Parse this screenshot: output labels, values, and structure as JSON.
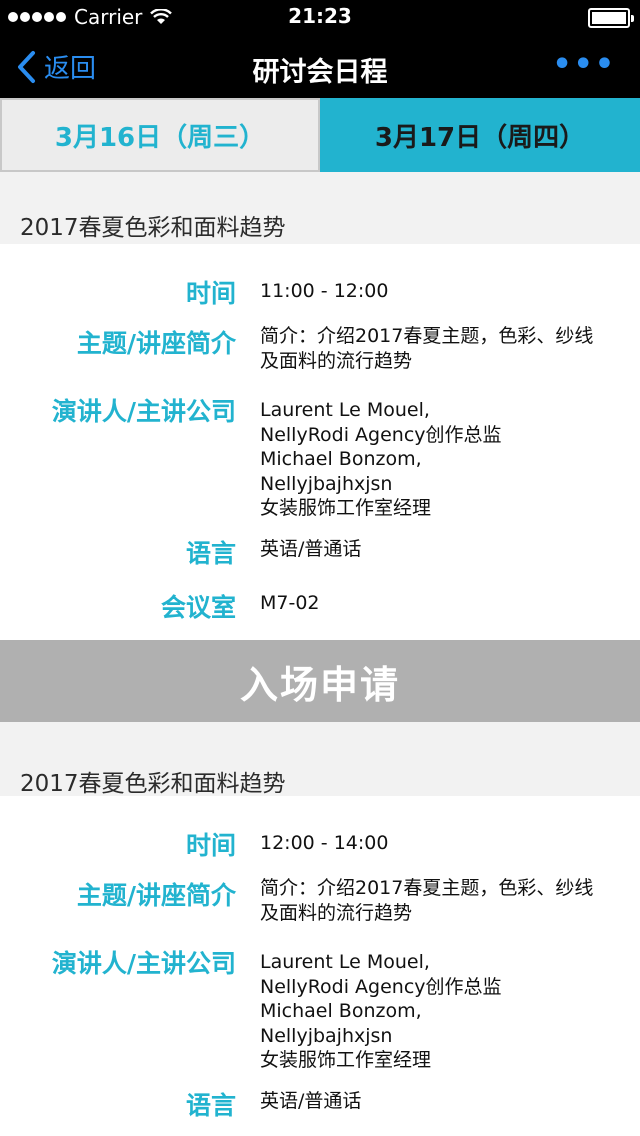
{
  "statusbar": {
    "carrier": "Carrier",
    "time": "21:23"
  },
  "navbar": {
    "back_label": "返回",
    "title": "研讨会日程",
    "more_label": "•••"
  },
  "tabs": [
    {
      "label": "3月16日（周三）",
      "active": false
    },
    {
      "label": "3月17日（周四）",
      "active": true
    }
  ],
  "labels": {
    "time": "时间",
    "topic": "主题/讲座简介",
    "speaker": "演讲人/主讲公司",
    "language": "语言",
    "room": "会议室"
  },
  "apply_label": "入场申请",
  "sessions": [
    {
      "title": "2017春夏色彩和面料趋势",
      "time": "11:00 - 12:00",
      "topic": "简介：介绍2017春夏主题，色彩、纱线及面料的流行趋势",
      "speaker": [
        "Laurent Le Mouel,",
        "NellyRodi Agency创作总监",
        "Michael Bonzom,",
        "Nellyjbajhxjsn",
        "女装服饰工作室经理"
      ],
      "language": "英语/普通话",
      "room": "M7-02"
    },
    {
      "title": "2017春夏色彩和面料趋势",
      "time": "12:00 - 14:00",
      "topic": "简介：介绍2017春夏主题，色彩、纱线及面料的流行趋势",
      "speaker": [
        "Laurent Le Mouel,",
        "NellyRodi Agency创作总监",
        "Michael Bonzom,",
        "Nellyjbajhxjsn",
        "女装服饰工作室经理"
      ],
      "language": "英语/普通话"
    }
  ],
  "colors": {
    "accent": "#22b3cf",
    "link": "#2a8df0",
    "apply_bg": "#b0b0b0"
  }
}
